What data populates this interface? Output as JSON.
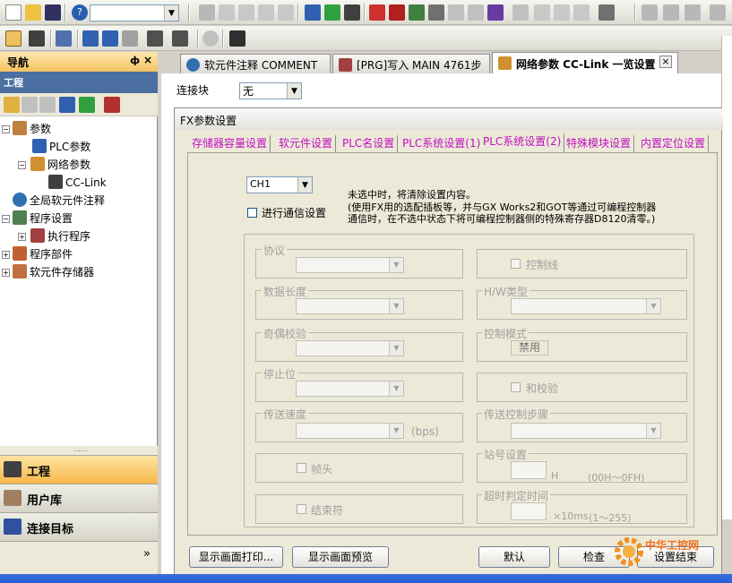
{
  "toolbar": {
    "font_combo_value": ""
  },
  "nav": {
    "title": "导航",
    "pin": "ф",
    "close": "×",
    "section": "工程",
    "tree": [
      {
        "label": "参数",
        "icon": "param-icon"
      },
      {
        "label": "PLC参数",
        "icon": "plc-param-icon"
      },
      {
        "label": "网络参数",
        "icon": "network-param-icon"
      },
      {
        "label": "CC-Link",
        "icon": "cclink-icon"
      },
      {
        "label": "全局软元件注释",
        "icon": "global-comment-icon"
      },
      {
        "label": "程序设置",
        "icon": "program-setting-icon"
      },
      {
        "label": "执行程序",
        "icon": "exec-program-icon"
      },
      {
        "label": "程序部件",
        "icon": "program-parts-icon"
      },
      {
        "label": "软元件存储器",
        "icon": "device-memory-icon"
      }
    ],
    "bottom_buttons": [
      "工程",
      "用户库",
      "连接目标"
    ],
    "grip": "……",
    "more": "»"
  },
  "tabs": [
    {
      "label": "软元件注释 COMMENT"
    },
    {
      "label": "[PRG]写入 MAIN 4761步"
    },
    {
      "label": "网络参数  CC-Link 一览设置"
    }
  ],
  "tab_close": "×",
  "doc": {
    "link_label": "连接块",
    "link_value": "无"
  },
  "dialog": {
    "title": "FX参数设置",
    "tabs": [
      "存储器容量设置",
      "软元件设置",
      "PLC名设置",
      "PLC系统设置(1)",
      "PLC系统设置(2)",
      "特殊模块设置",
      "内置定位设置"
    ],
    "ch_value": "CH1",
    "comm_checkbox_label": "进行通信设置",
    "note_lines": [
      "未选中时，将清除设置内容。",
      "(使用FX用的选配插板等，并与GX Works2和GOT等通过可编程控制器",
      "通信时，在不选中状态下将可编程控制器侧的特殊寄存器D8120清零。)"
    ],
    "left_groups": [
      "协议",
      "数据长度",
      "奇偶校验",
      "停止位",
      "传送速度"
    ],
    "bps": "(bps)",
    "header_label": "帧头",
    "terminator_label": "结束符",
    "control_line_label": "控制线",
    "hw_type_label": "H/W类型",
    "control_mode_label": "控制模式",
    "control_mode_value": "禁用",
    "sum_check_label": "和校验",
    "trans_step_label": "传送控制步骤",
    "station_label": "站号设置",
    "station_unit": "H",
    "station_range": "(00H～0FH)",
    "timeout_label": "超时判定时间",
    "timeout_unit": "×10ms",
    "timeout_range": "(1～255)",
    "buttons": [
      "显示画面打印...",
      "显示画面预览",
      "默认",
      "检查",
      "设置结束"
    ]
  },
  "watermark": "中华工控网",
  "colors": {
    "nav_header": "#f5c361",
    "tab_text": "#c010c0",
    "nav_section": "#4a6fa0"
  }
}
